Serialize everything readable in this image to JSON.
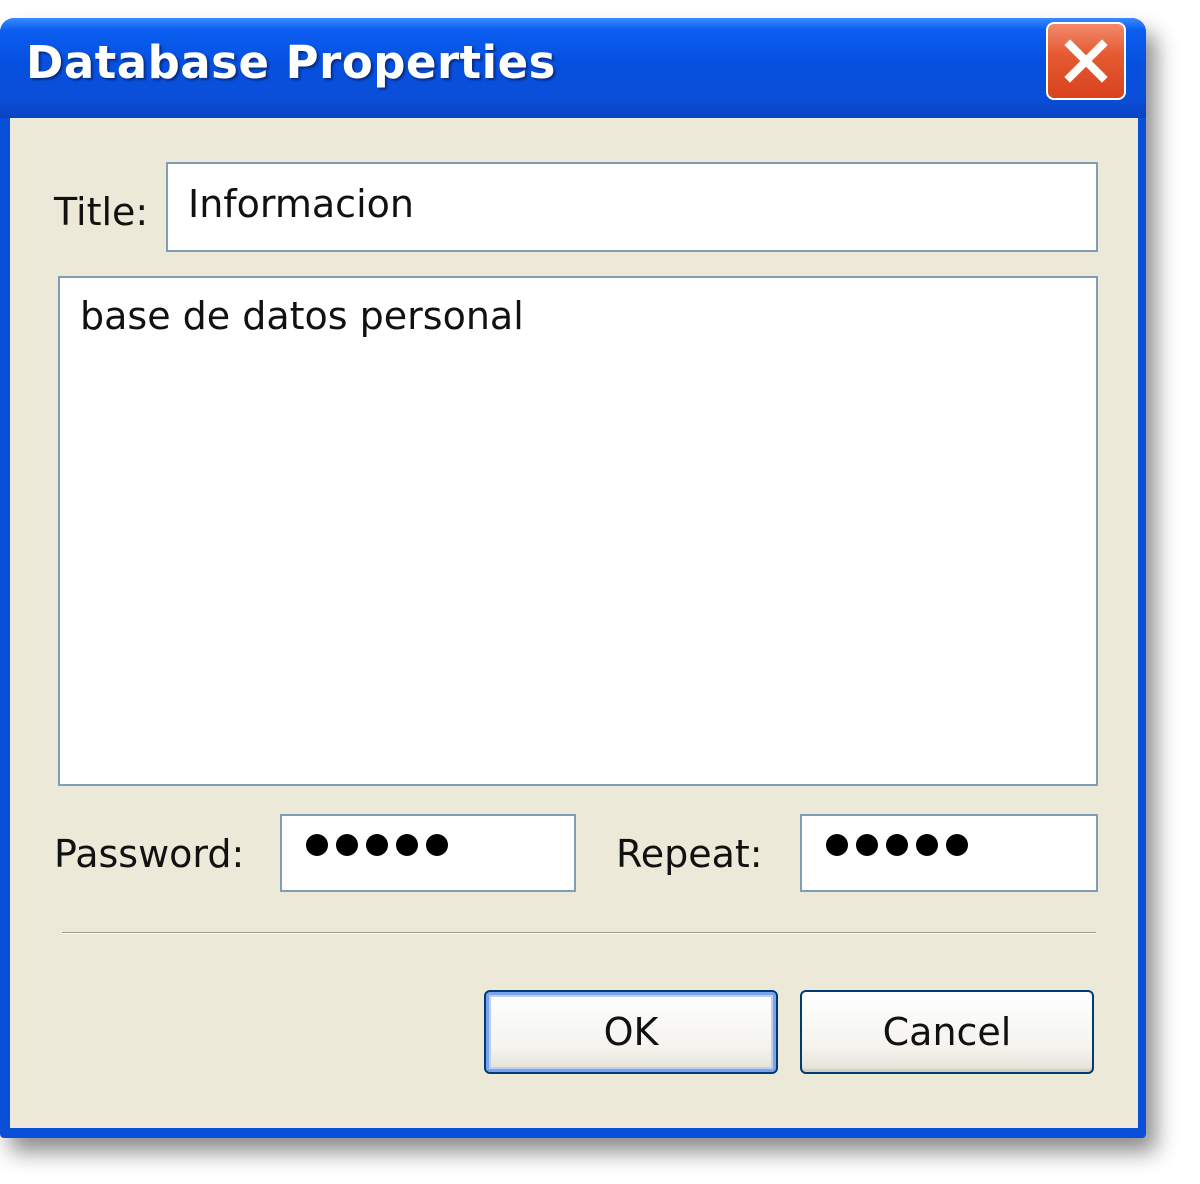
{
  "window": {
    "title": "Database Properties"
  },
  "icons": {
    "close": "close-icon"
  },
  "form": {
    "title_label": "Title:",
    "title_value": "Informacion",
    "description_value": "base de datos personal",
    "password_label": "Password:",
    "password_masked_length": 5,
    "repeat_label": "Repeat:",
    "repeat_masked_length": 5
  },
  "buttons": {
    "ok_label": "OK",
    "cancel_label": "Cancel"
  },
  "colors": {
    "titlebar": "#0a4fd8",
    "close_button": "#e55b33",
    "dialog_background": "#ece9d8"
  }
}
